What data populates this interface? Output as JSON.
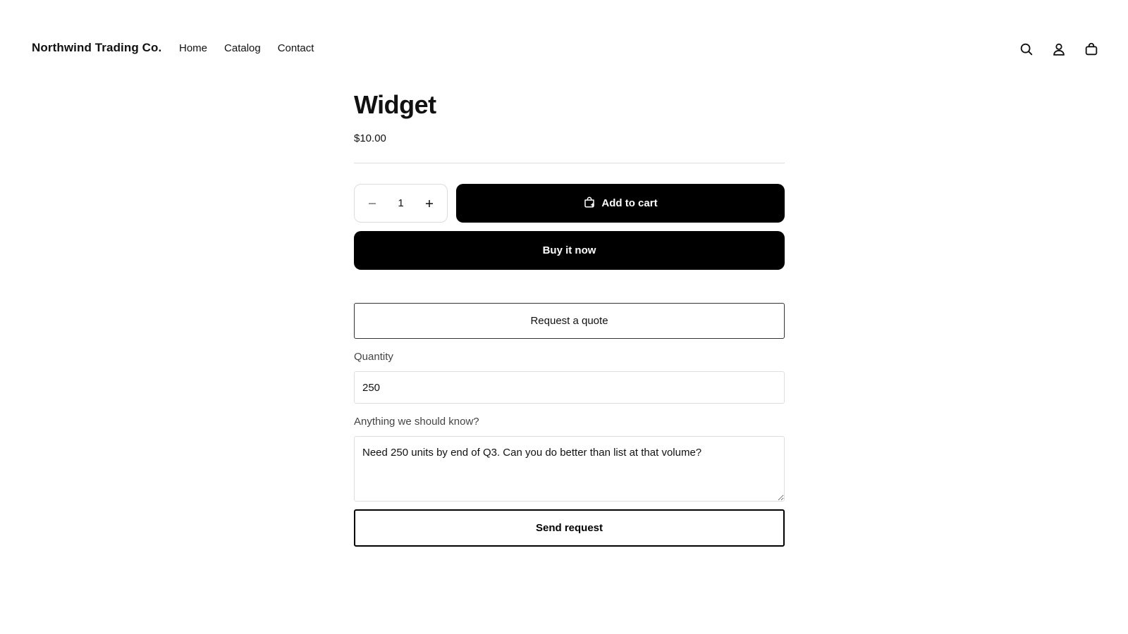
{
  "header": {
    "brand": "Northwind Trading Co.",
    "nav": [
      {
        "label": "Home"
      },
      {
        "label": "Catalog"
      },
      {
        "label": "Contact"
      }
    ],
    "icons": [
      "search-icon",
      "account-icon",
      "cart-icon"
    ]
  },
  "product": {
    "title": "Widget",
    "price": "$10.00",
    "quantity": "1",
    "add_to_cart_label": "Add to cart",
    "buy_now_label": "Buy it now"
  },
  "quote": {
    "toggle_label": "Request a quote",
    "quantity_label": "Quantity",
    "quantity_value": "250",
    "notes_label": "Anything we should know?",
    "notes_value": "Need 250 units by end of Q3. Can you do better than list at that volume?",
    "send_label": "Send request"
  }
}
